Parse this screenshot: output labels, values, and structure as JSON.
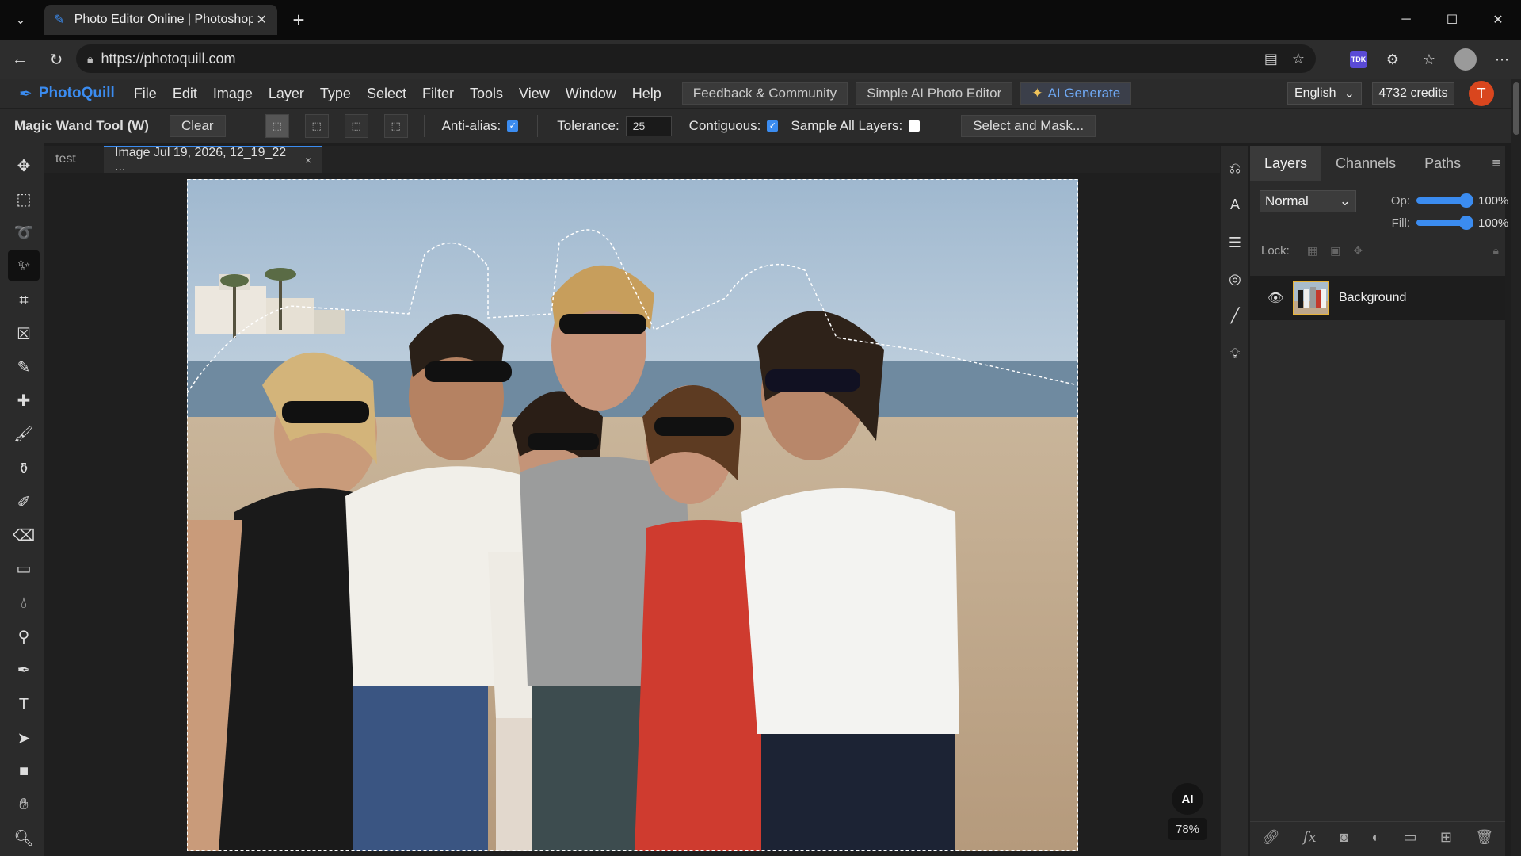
{
  "browser": {
    "tab_title": "Photo Editor Online | Photoshop A",
    "url": "https://photoquill.com"
  },
  "app": {
    "logo": "PhotoQuill",
    "menu": [
      "File",
      "Edit",
      "Image",
      "Layer",
      "Type",
      "Select",
      "Filter",
      "Tools",
      "View",
      "Window",
      "Help"
    ],
    "feedback_btn": "Feedback & Community",
    "simple_ai_btn": "Simple AI Photo Editor",
    "ai_generate_btn": "AI Generate",
    "language": "English",
    "credits": "4732 credits",
    "user_initial": "T"
  },
  "options": {
    "tool_name": "Magic Wand Tool (W)",
    "clear": "Clear",
    "anti_alias_label": "Anti-alias:",
    "anti_alias": true,
    "tolerance_label": "Tolerance:",
    "tolerance_value": "25",
    "contiguous_label": "Contiguous:",
    "contiguous": true,
    "sample_all_label": "Sample All Layers:",
    "sample_all": false,
    "select_mask": "Select and Mask..."
  },
  "documents": {
    "tabs": [
      {
        "label": "test",
        "active": false
      },
      {
        "label": "Image Jul 19, 2026, 12_19_22 ...",
        "active": true
      }
    ],
    "close_glyph": "×",
    "ai_badge": "AI",
    "zoom": "78%"
  },
  "layers": {
    "tabs": [
      "Layers",
      "Channels",
      "Paths"
    ],
    "blend_mode": "Normal",
    "opacity_label": "Op:",
    "opacity": "100%",
    "fill_label": "Fill:",
    "fill": "100%",
    "lock_label": "Lock:",
    "items": [
      {
        "name": "Background",
        "visible": true
      }
    ]
  },
  "colors": {
    "accent": "#3b8cf0",
    "avatar": "#d9461e",
    "selected_layer_border": "#e8b43a"
  }
}
